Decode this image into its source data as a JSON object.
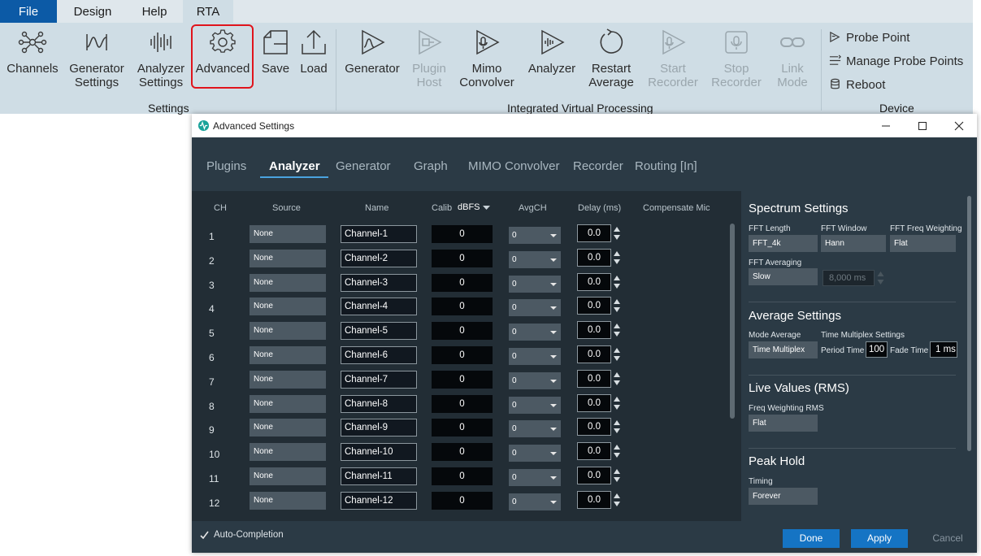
{
  "menu": {
    "tabs": [
      {
        "label": "File"
      },
      {
        "label": "Design"
      },
      {
        "label": "Help"
      },
      {
        "label": "RTA"
      }
    ]
  },
  "ribbon": {
    "settings_group": {
      "label": "Settings",
      "buttons": [
        {
          "label": "Channels",
          "icon": "channels-icon"
        },
        {
          "label": "Generator\nSettings",
          "icon": "generator-settings-icon"
        },
        {
          "label": "Analyzer\nSettings",
          "icon": "analyzer-settings-icon"
        },
        {
          "label": "Advanced",
          "icon": "gear-icon"
        },
        {
          "label": "Save",
          "icon": "save-icon"
        },
        {
          "label": "Load",
          "icon": "load-icon"
        }
      ]
    },
    "ivp_group": {
      "label": "Integrated Virtual Processing",
      "buttons": [
        {
          "label": "Generator",
          "icon": "generator-icon"
        },
        {
          "label": "Plugin\nHost",
          "icon": "plugin-host-icon"
        },
        {
          "label": "Mimo\nConvolver",
          "icon": "mimo-convolver-icon"
        },
        {
          "label": "Analyzer",
          "icon": "analyzer-icon"
        },
        {
          "label": "Restart\nAverage",
          "icon": "restart-icon"
        },
        {
          "label": "Start\nRecorder",
          "icon": "start-recorder-icon"
        },
        {
          "label": "Stop\nRecorder",
          "icon": "stop-recorder-icon"
        },
        {
          "label": "Link\nMode",
          "icon": "link-icon"
        }
      ]
    },
    "device_group": {
      "label": "Device",
      "items": [
        {
          "label": "Probe Point",
          "icon": "probe-point-icon"
        },
        {
          "label": "Manage Probe Points",
          "icon": "manage-probe-points-icon"
        },
        {
          "label": "Reboot",
          "icon": "reboot-icon"
        }
      ]
    },
    "highlight_color": "#e0141c"
  },
  "dialog": {
    "title": "Advanced Settings",
    "tabs": [
      {
        "label": "Plugins"
      },
      {
        "label": "Analyzer"
      },
      {
        "label": "Generator"
      },
      {
        "label": "Graph"
      },
      {
        "label": "MIMO Convolver"
      },
      {
        "label": "Recorder"
      },
      {
        "label": "Routing [In]"
      }
    ],
    "table": {
      "headers": {
        "ch": "CH",
        "source": "Source",
        "name": "Name",
        "calib": "Calib",
        "calib_unit": "dBFS",
        "avgch": "AvgCH",
        "delay": "Delay (ms)",
        "compensate": "Compensate Mic"
      },
      "rows": [
        {
          "ch": "1",
          "source": "None",
          "name": "Channel-1",
          "calib": "0",
          "avgch": "0",
          "delay": "0.0"
        },
        {
          "ch": "2",
          "source": "None",
          "name": "Channel-2",
          "calib": "0",
          "avgch": "0",
          "delay": "0.0"
        },
        {
          "ch": "3",
          "source": "None",
          "name": "Channel-3",
          "calib": "0",
          "avgch": "0",
          "delay": "0.0"
        },
        {
          "ch": "4",
          "source": "None",
          "name": "Channel-4",
          "calib": "0",
          "avgch": "0",
          "delay": "0.0"
        },
        {
          "ch": "5",
          "source": "None",
          "name": "Channel-5",
          "calib": "0",
          "avgch": "0",
          "delay": "0.0"
        },
        {
          "ch": "6",
          "source": "None",
          "name": "Channel-6",
          "calib": "0",
          "avgch": "0",
          "delay": "0.0"
        },
        {
          "ch": "7",
          "source": "None",
          "name": "Channel-7",
          "calib": "0",
          "avgch": "0",
          "delay": "0.0"
        },
        {
          "ch": "8",
          "source": "None",
          "name": "Channel-8",
          "calib": "0",
          "avgch": "0",
          "delay": "0.0"
        },
        {
          "ch": "9",
          "source": "None",
          "name": "Channel-9",
          "calib": "0",
          "avgch": "0",
          "delay": "0.0"
        },
        {
          "ch": "10",
          "source": "None",
          "name": "Channel-10",
          "calib": "0",
          "avgch": "0",
          "delay": "0.0"
        },
        {
          "ch": "11",
          "source": "None",
          "name": "Channel-11",
          "calib": "0",
          "avgch": "0",
          "delay": "0.0"
        },
        {
          "ch": "12",
          "source": "None",
          "name": "Channel-12",
          "calib": "0",
          "avgch": "0",
          "delay": "0.0"
        }
      ]
    },
    "spectrum": {
      "title": "Spectrum Settings",
      "fft_length_label": "FFT Length",
      "fft_length": "FFT_4k",
      "fft_window_label": "FFT Window",
      "fft_window": "Hann",
      "fft_weight_label": "FFT Freq Weighting",
      "fft_weight": "Flat",
      "fft_avg_label": "FFT Averaging",
      "fft_avg": "Slow",
      "fft_avg_ms": "8,000 ms"
    },
    "average": {
      "title": "Average Settings",
      "mode_label": "Mode Average",
      "mode": "Time Multiplex",
      "tm_label": "Time Multiplex Settings",
      "period_label": "Period Time",
      "period": "100 r",
      "fade_label": "Fade Time",
      "fade": "1 ms"
    },
    "live": {
      "title": "Live Values (RMS)",
      "weight_label": "Freq Weighting RMS",
      "weight": "Flat"
    },
    "peak": {
      "title": "Peak Hold",
      "timing_label": "Timing",
      "timing": "Forever"
    },
    "footer": {
      "autocompletion": "Auto-Completion",
      "done": "Done",
      "apply": "Apply",
      "cancel": "Cancel"
    }
  }
}
